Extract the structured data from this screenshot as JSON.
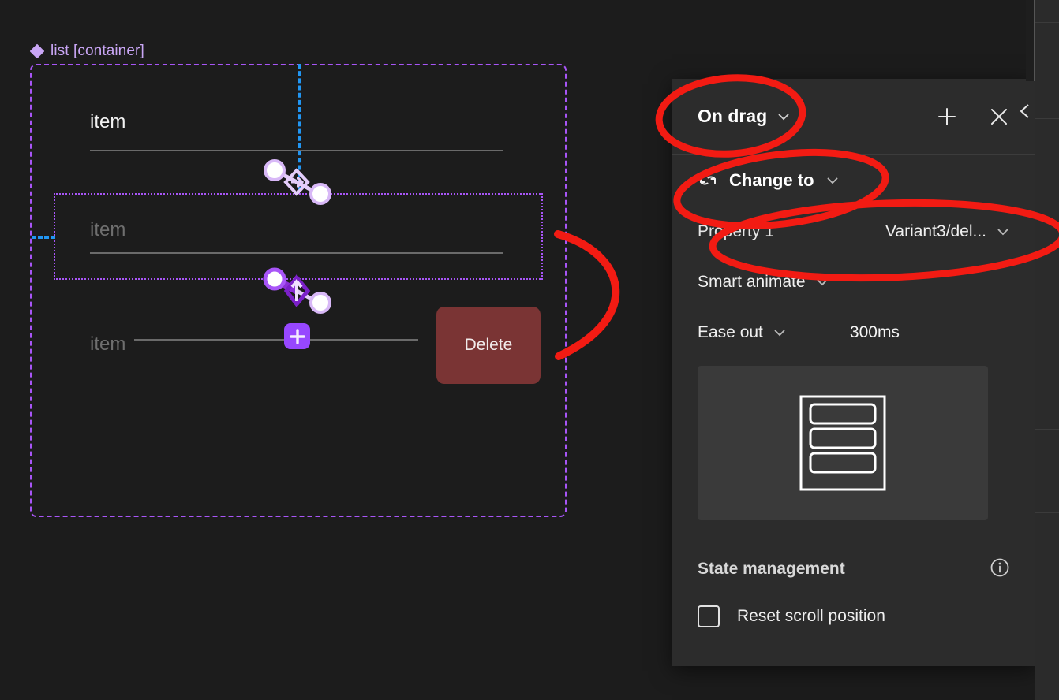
{
  "canvas": {
    "container_label": "list [container]",
    "container_icon": "component-diamond-icon",
    "rows": [
      {
        "text": "item",
        "state": "active"
      },
      {
        "text": "item",
        "state": "dim"
      },
      {
        "text": "item",
        "state": "dim"
      }
    ],
    "delete_button_label": "Delete",
    "add_button_icon": "plus-icon",
    "connector_icon": "interaction-connector-icon",
    "colors": {
      "container_outline": "#a855f7",
      "selection_outline": "#a855f7",
      "guide_blue": "#2196f3",
      "accent_purple": "#9747ff",
      "delete_fill": "#7a3434",
      "annotation_red": "#f21b13",
      "canvas_bg": "#1c1c1c"
    }
  },
  "panel": {
    "title": "On drag",
    "title_chevron_icon": "chevron-down-icon",
    "add_icon": "plus-icon",
    "close_icon": "close-icon",
    "action": {
      "icon": "change-to-swap-icon",
      "label": "Change to",
      "chevron_icon": "chevron-down-icon"
    },
    "property": {
      "name": "Property 1",
      "value": "Variant3/del...",
      "chevron_icon": "chevron-down-icon"
    },
    "animation": {
      "type": "Smart animate",
      "chevron_icon": "chevron-down-icon",
      "easing": "Ease out",
      "easing_chevron_icon": "chevron-down-icon",
      "duration": "300ms"
    },
    "preview": {
      "icon": "list-frame-preview-icon"
    },
    "state_management": {
      "heading": "State management",
      "info_icon": "info-icon",
      "checkbox": {
        "label": "Reset scroll position",
        "checked": false
      }
    },
    "colors": {
      "panel_bg": "#2c2c2c",
      "preview_bg": "#3a3a3a",
      "divider": "#3c3c3c"
    }
  },
  "annotations": {
    "color": "#f21b13",
    "highlights": [
      "On drag",
      "Change to",
      "Property 1 / Variant3/del...",
      "arrow pointing from Delete area to panel"
    ]
  }
}
